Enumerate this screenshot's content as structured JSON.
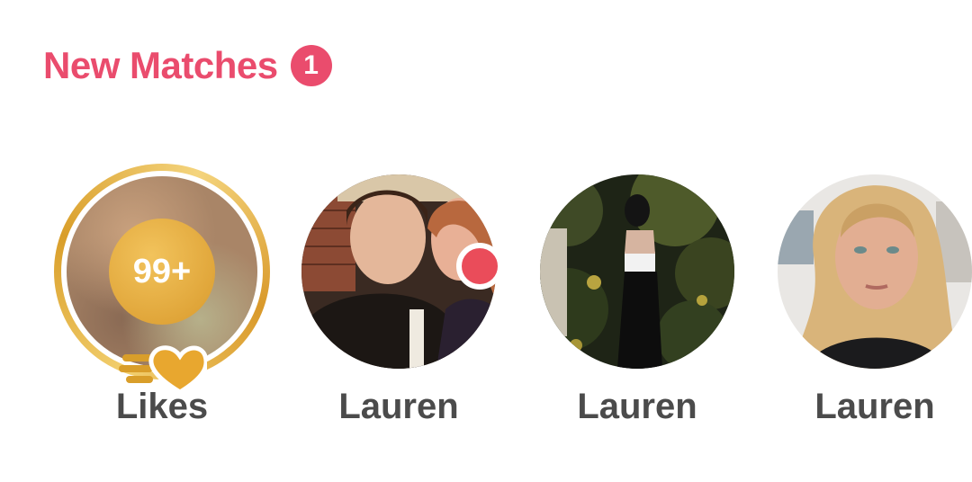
{
  "section": {
    "title": "New Matches",
    "count_badge": "1"
  },
  "likes": {
    "count": "99+",
    "label": "Likes",
    "accent_color": "#d99e2a"
  },
  "matches": [
    {
      "name": "Lauren",
      "has_new_indicator": true
    },
    {
      "name": "Lauren",
      "has_new_indicator": false
    },
    {
      "name": "Lauren",
      "has_new_indicator": false
    }
  ],
  "colors": {
    "brand": "#ea4c6d",
    "label_text": "#4b4b4b",
    "gold": "#d99e2a"
  }
}
